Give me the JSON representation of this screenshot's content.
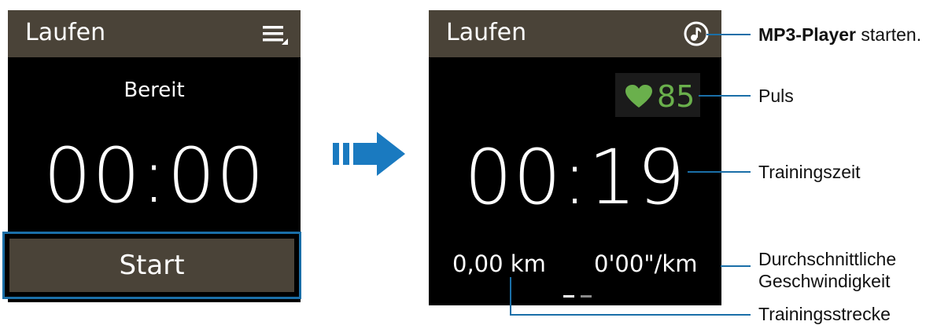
{
  "left_screen": {
    "title": "Laufen",
    "menu_icon": "menu-icon",
    "status": "Bereit",
    "timer": "00:00",
    "start_label": "Start"
  },
  "arrow_icon": "arrow-right-icon",
  "right_screen": {
    "title": "Laufen",
    "music_icon": "music-note-icon",
    "heart_icon": "heart-icon",
    "pulse": "85",
    "timer": "00:19",
    "distance": "0,00 km",
    "pace": "0'00\"/km",
    "page_indicator": {
      "count": 2,
      "active": 1
    }
  },
  "callouts": {
    "mp3_bold": "MP3-Player",
    "mp3_rest": " starten.",
    "pulse": "Puls",
    "time": "Trainingszeit",
    "speed_line1": "Durchschnittliche",
    "speed_line2": "Geschwindigkeit",
    "distance": "Trainingsstrecke"
  },
  "colors": {
    "title_bar": "#4a4338",
    "start_button": "#4a4338",
    "highlight_border": "#1a6fa8",
    "heart": "#6ab04c",
    "arrow": "#1a7ac0",
    "callout_line": "#1a6fa8"
  }
}
